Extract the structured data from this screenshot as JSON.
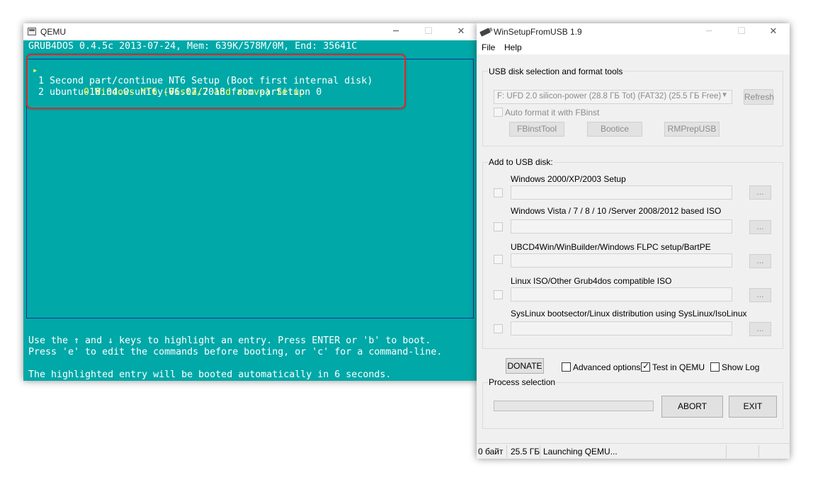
{
  "qemu": {
    "title": "QEMU",
    "console": {
      "header": "GRUB4DOS 0.4.5c 2013-07-24, Mem: 639K/578M/0M, End: 35641C",
      "entries": [
        "0 Windows NT6 (Vista/7 and above) Setup",
        "1 Second part/continue NT6 Setup (Boot first internal disk)",
        "2 ubuntu-18.04.0-unity-06.07.2018 from partition 0"
      ],
      "selected_index": 0,
      "help_line1": "Use the ↑ and ↓ keys to highlight an entry. Press ENTER or 'b' to boot.",
      "help_line2": "Press 'e' to edit the commands before booting, or 'c' for a command-line.",
      "countdown": "The highlighted entry will be booted automatically in 6 seconds."
    },
    "colors": {
      "console_bg": "#00a8a8",
      "selected_text": "#ffff55",
      "callout": "#d82b2b"
    }
  },
  "wsfu": {
    "title": "WinSetupFromUSB 1.9",
    "menu": [
      "File",
      "Help"
    ],
    "usb_group": {
      "label": "USB disk selection and format tools",
      "disk": "F: UFD 2.0 silicon-power (28.8 ГБ Tot) (FAT32) (25.5 ГБ Free)",
      "refresh": "Refresh",
      "auto_format": "Auto format it with FBinst",
      "tools": [
        "FBinstTool",
        "Bootice",
        "RMPrepUSB"
      ]
    },
    "add_group": {
      "label": "Add to USB disk:",
      "items": [
        "Windows 2000/XP/2003 Setup",
        "Windows Vista / 7 / 8 / 10 /Server 2008/2012 based ISO",
        "UBCD4Win/WinBuilder/Windows FLPC setup/BartPE",
        "Linux ISO/Other Grub4dos compatible ISO",
        "SysLinux bootsector/Linux distribution using SysLinux/IsoLinux"
      ],
      "browse": "..."
    },
    "donate": "DONATE",
    "options": [
      {
        "label": "Advanced options",
        "checked": false
      },
      {
        "label": "Test in QEMU",
        "checked": true
      },
      {
        "label": "Show Log",
        "checked": false
      }
    ],
    "process_group": {
      "label": "Process selection",
      "progress": 0,
      "abort": "ABORT",
      "exit": "EXIT"
    },
    "status": {
      "free": "0 байт",
      "size": "25.5 ГБ",
      "message": "Launching QEMU..."
    }
  }
}
